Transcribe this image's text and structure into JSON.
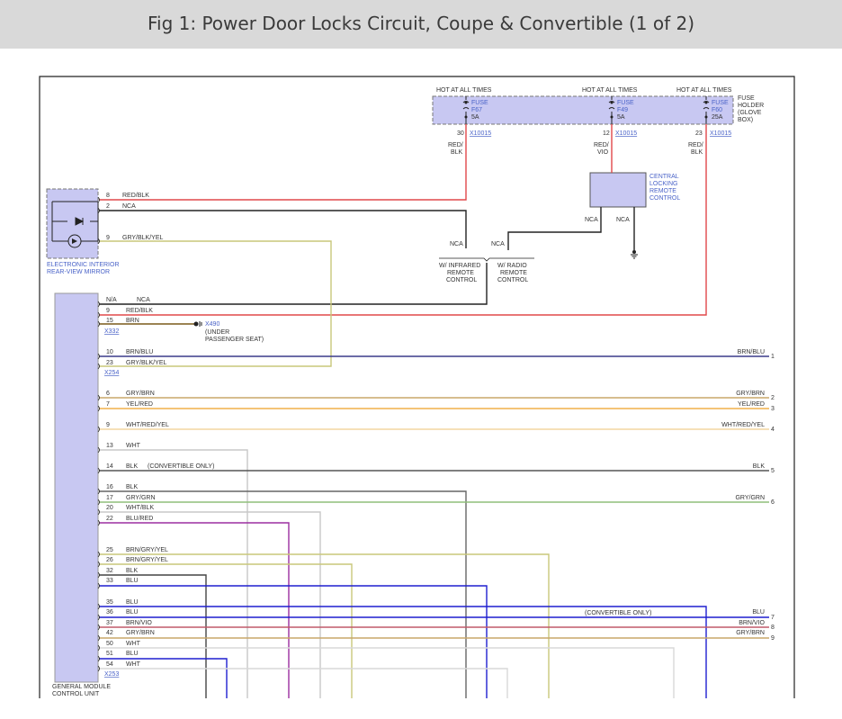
{
  "title": "Fig 1: Power Door Locks Circuit, Coupe & Convertible (1 of 2)",
  "fuse_block": {
    "hot_labels": [
      "HOT AT ALL TIMES",
      "HOT AT ALL TIMES",
      "HOT AT ALL TIMES"
    ],
    "fuses": [
      {
        "line1": "FUSE",
        "line2": "F67",
        "line3": "5A",
        "pin": "30",
        "conn": "X10015",
        "wire": [
          "RED/",
          "BLK"
        ]
      },
      {
        "line1": "FUSE",
        "line2": "F49",
        "line3": "5A",
        "pin": "12",
        "conn": "X10015",
        "wire": [
          "RED/",
          "VIO"
        ]
      },
      {
        "line1": "FUSE",
        "line2": "F60",
        "line3": "25A",
        "pin": "23",
        "conn": "X10015",
        "wire": [
          "RED/",
          "BLK"
        ]
      }
    ],
    "holder_label": [
      "FUSE",
      "HOLDER",
      "(GLOVE",
      "BOX)"
    ]
  },
  "central_locking": {
    "label": [
      "CENTRAL",
      "LOCKING",
      "REMOTE",
      "CONTROL"
    ],
    "nca_left": "NCA",
    "nca_right": "NCA"
  },
  "options": {
    "infrared_nca": "NCA",
    "radio_nca": "NCA",
    "infrared": [
      "W/ INFRARED",
      "REMOTE",
      "CONTROL"
    ],
    "radio": [
      "W/ RADIO",
      "REMOTE",
      "CONTROL"
    ]
  },
  "mirror": {
    "label": [
      "ELECTRONIC INTERIOR",
      "REAR-VIEW MIRROR"
    ],
    "pins": [
      {
        "pin": "8",
        "wire": "RED/BLK"
      },
      {
        "pin": "2",
        "wire": "NCA"
      },
      {
        "pin": "9",
        "wire": "GRY/BLK/YEL"
      }
    ]
  },
  "ground": {
    "label": "X490",
    "desc": [
      "(UNDER",
      "PASSENGER SEAT)"
    ]
  },
  "module": {
    "label": [
      "GENERAL MODULE",
      "CONTROL UNIT"
    ],
    "connectors": {
      "x332": "X332",
      "x254": "X254",
      "x253": "X253"
    },
    "pins": [
      {
        "pin": "N/A",
        "wire": "NCA"
      },
      {
        "pin": "9",
        "wire": "RED/BLK"
      },
      {
        "pin": "15",
        "wire": "BRN"
      },
      {
        "pin": "10",
        "wire": "BRN/BLU"
      },
      {
        "pin": "23",
        "wire": "GRY/BLK/YEL"
      },
      {
        "pin": "6",
        "wire": "GRY/BRN"
      },
      {
        "pin": "7",
        "wire": "YEL/RED"
      },
      {
        "pin": "9",
        "wire": "WHT/RED/YEL"
      },
      {
        "pin": "13",
        "wire": "WHT"
      },
      {
        "pin": "14",
        "wire": "BLK"
      },
      {
        "pin": "16",
        "wire": "BLK"
      },
      {
        "pin": "17",
        "wire": "GRY/GRN"
      },
      {
        "pin": "20",
        "wire": "WHT/BLK"
      },
      {
        "pin": "22",
        "wire": "BLU/RED"
      },
      {
        "pin": "25",
        "wire": "BRN/GRY/YEL"
      },
      {
        "pin": "26",
        "wire": "BRN/GRY/YEL"
      },
      {
        "pin": "32",
        "wire": "BLK"
      },
      {
        "pin": "33",
        "wire": "BLU"
      },
      {
        "pin": "35",
        "wire": "BLU"
      },
      {
        "pin": "36",
        "wire": "BLU"
      },
      {
        "pin": "37",
        "wire": "BRN/VIO"
      },
      {
        "pin": "42",
        "wire": "GRY/BRN"
      },
      {
        "pin": "50",
        "wire": "WHT"
      },
      {
        "pin": "51",
        "wire": "BLU"
      },
      {
        "pin": "54",
        "wire": "WHT"
      }
    ],
    "convertible_only_14": "(CONVERTIBLE ONLY)",
    "convertible_only_36": "(CONVERTIBLE ONLY)"
  },
  "right_outputs": [
    {
      "wire": "BRN/BLU",
      "num": "1"
    },
    {
      "wire": "GRY/BRN",
      "num": "2"
    },
    {
      "wire": "YEL/RED",
      "num": "3"
    },
    {
      "wire": "WHT/RED/YEL",
      "num": "4"
    },
    {
      "wire": "BLK",
      "num": "5"
    },
    {
      "wire": "GRY/GRN",
      "num": "6"
    },
    {
      "wire": "BLU",
      "num": "7"
    },
    {
      "wire": "BRN/VIO",
      "num": "8"
    },
    {
      "wire": "GRY/BRN",
      "num": "9"
    }
  ],
  "colors": {
    "red": "#e0484a",
    "black": "#222222",
    "olive": "#c9c77a",
    "brown": "#7a5a1a",
    "navy": "#3b3b8a",
    "tan": "#c8a76a",
    "orange": "#f0b04a",
    "white_wire": "#c8c8c8",
    "gray": "#7a7a7a",
    "green": "#8fbf7a",
    "purple": "#9b2ea0",
    "blue": "#1f1fcf",
    "rose": "#c05a6a",
    "component_fill": "#c8c8f2"
  }
}
